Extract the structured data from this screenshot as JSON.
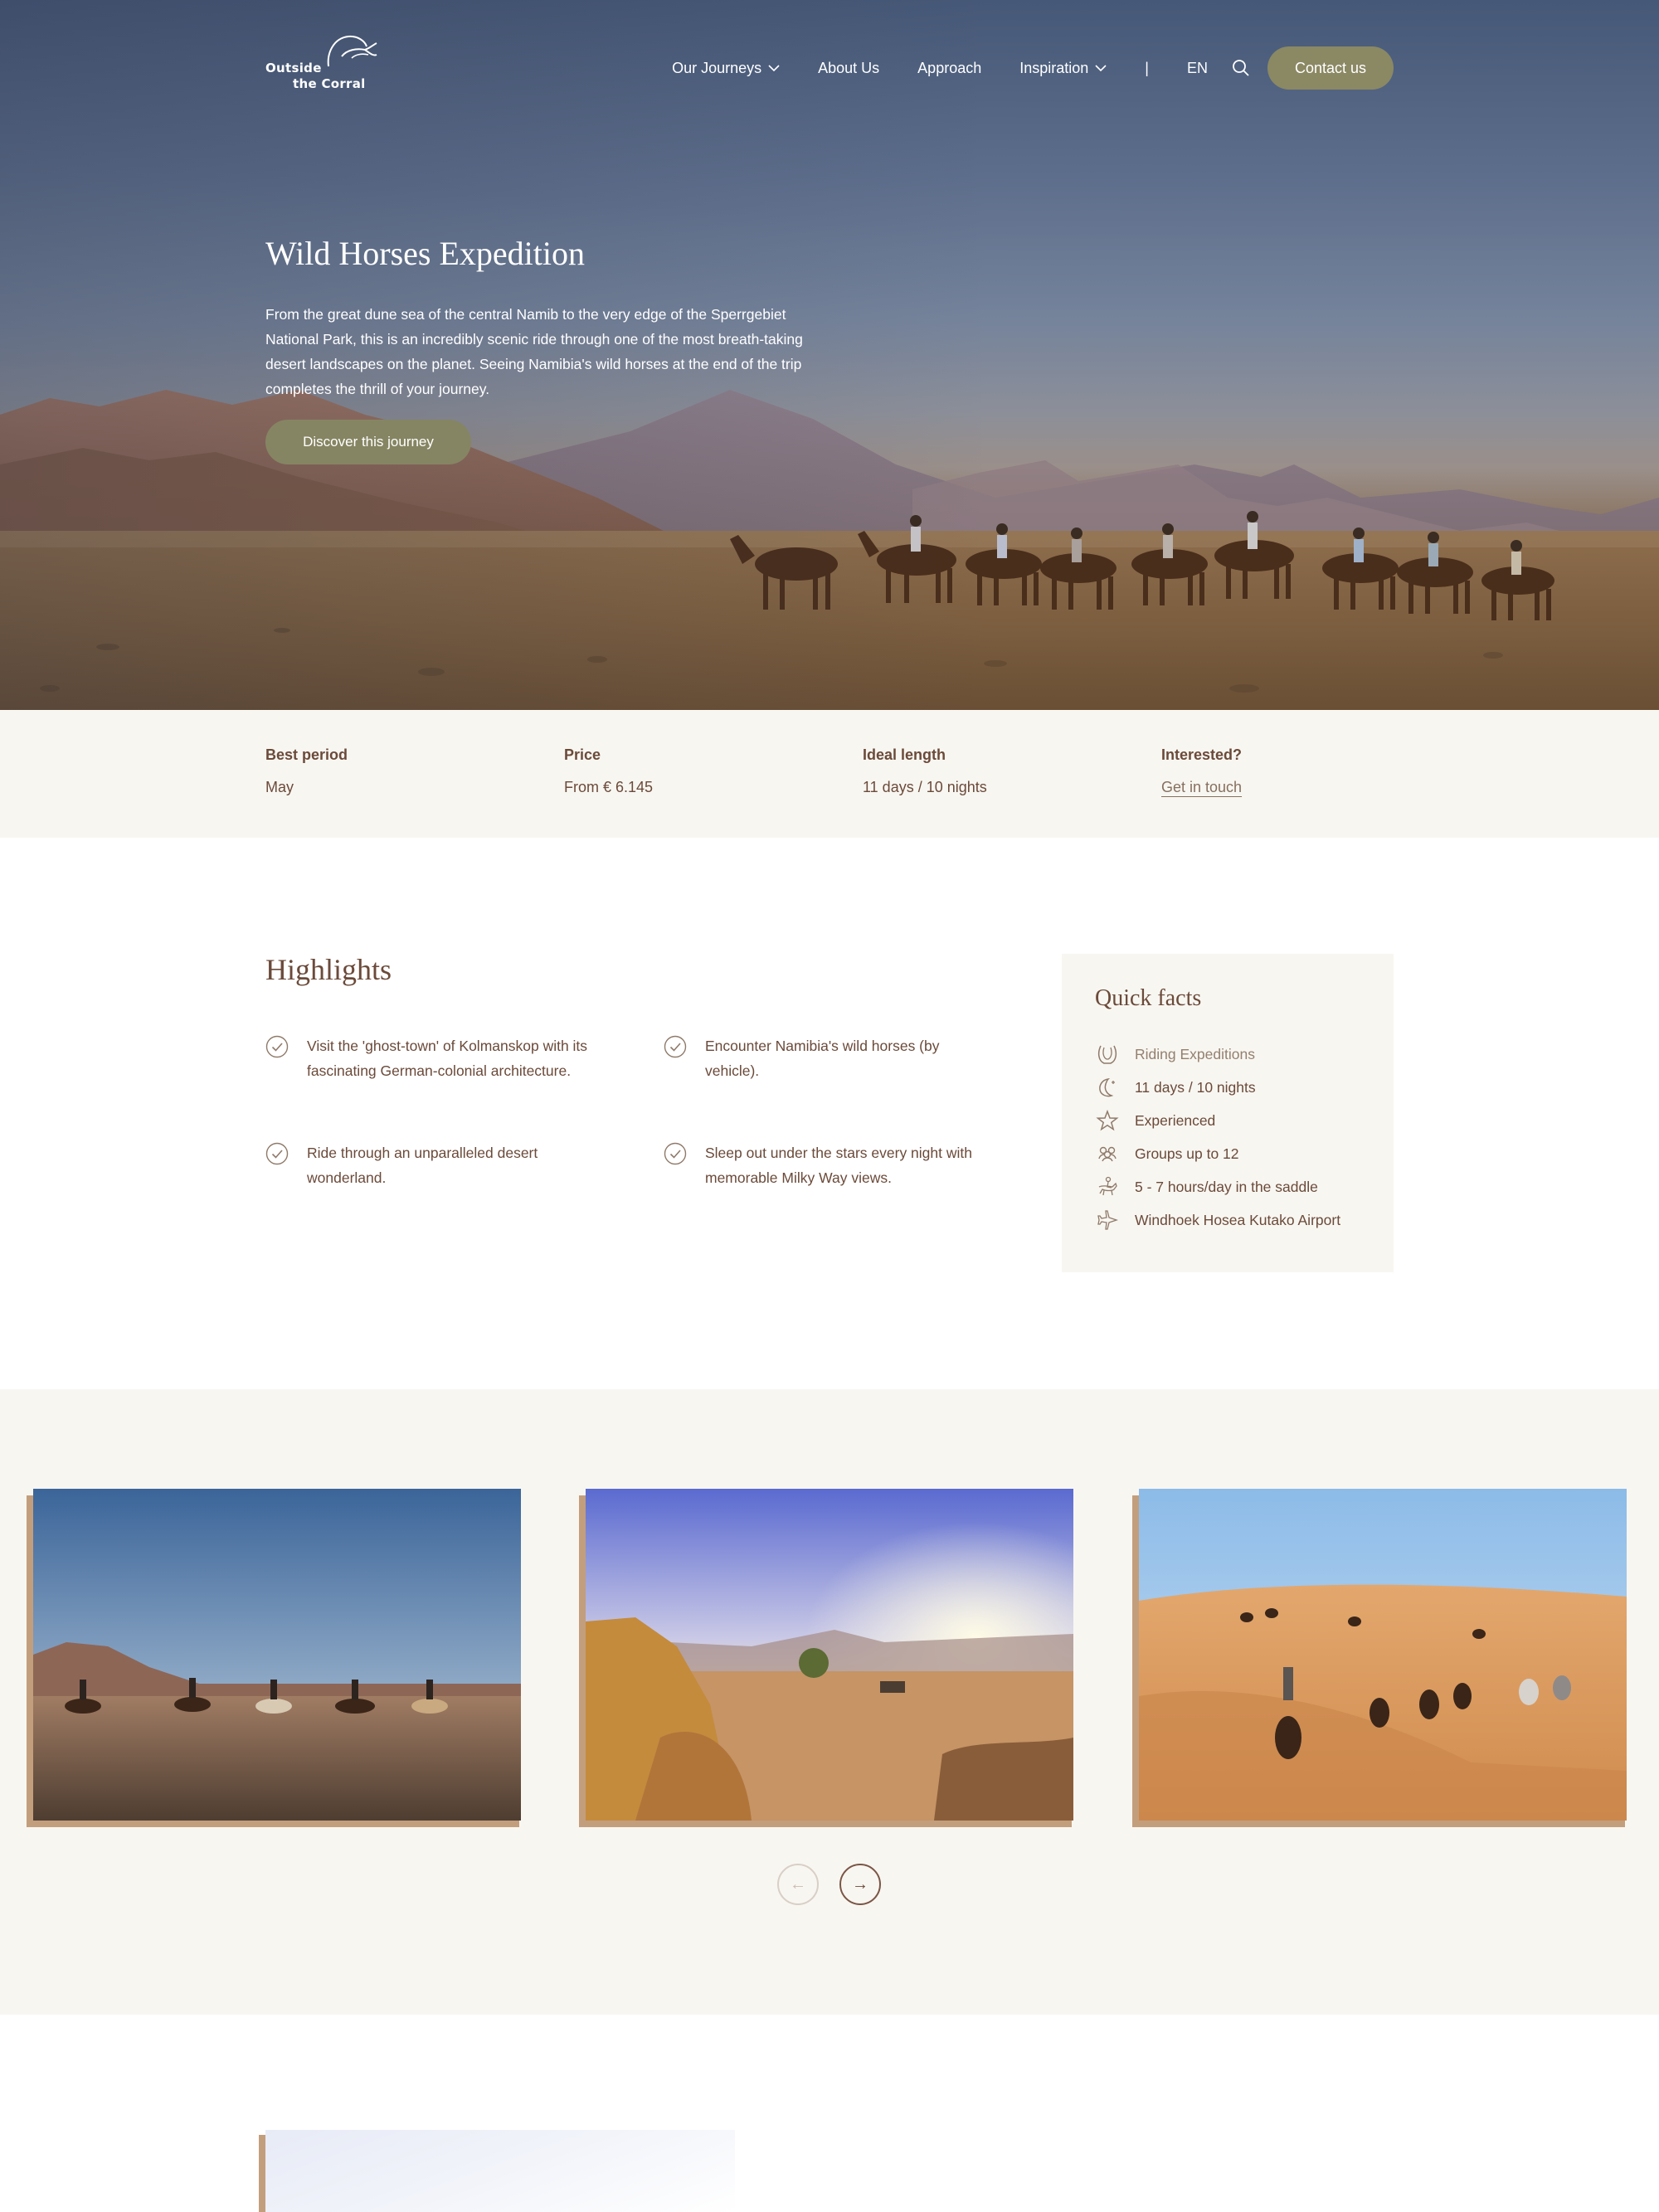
{
  "nav": {
    "logo_line1": "Outside",
    "logo_line2": "the Corral",
    "items": [
      {
        "label": "Our Journeys",
        "has_dropdown": true
      },
      {
        "label": "About Us",
        "has_dropdown": false
      },
      {
        "label": "Approach",
        "has_dropdown": false
      },
      {
        "label": "Inspiration",
        "has_dropdown": true
      }
    ],
    "separator": "|",
    "language": "EN",
    "search_icon": "search-icon",
    "contact_label": "Contact us"
  },
  "hero": {
    "title": "Wild Horses Expedition",
    "description": "From the great dune sea of the central Namib to the very edge of the Sperrgebiet National Park, this is an incredibly scenic ride through one of the most breath-taking desert landscapes on the planet. Seeing Namibia's wild horses at the end of the trip completes the thrill of your journey.",
    "button_label": "Discover this journey"
  },
  "info": [
    {
      "label": "Best period",
      "value": "May"
    },
    {
      "label": "Price",
      "value": "From € 6.145"
    },
    {
      "label": "Ideal length",
      "value": "11 days / 10 nights"
    },
    {
      "label": "Interested?",
      "value": "Get in touch"
    }
  ],
  "highlights": {
    "title": "Highlights",
    "items": [
      "Visit the 'ghost-town' of Kolmanskop with its fascinating German-colonial architecture.",
      "Encounter Namibia's wild horses (by vehicle).",
      "Ride through an unparalleled desert wonderland.",
      "Sleep out under the stars every night with memorable Milky Way views."
    ]
  },
  "quick_facts": {
    "title": "Quick facts",
    "items": [
      {
        "icon": "horseshoe-icon",
        "label": "Riding Expeditions"
      },
      {
        "icon": "moon-icon",
        "label": "11 days / 10 nights"
      },
      {
        "icon": "star-icon",
        "label": "Experienced"
      },
      {
        "icon": "group-icon",
        "label": "Groups up to 12"
      },
      {
        "icon": "rider-icon",
        "label": "5 - 7 hours/day in the saddle"
      },
      {
        "icon": "plane-icon",
        "label": "Windhoek Hosea Kutako Airport"
      }
    ]
  },
  "gallery": {
    "images": [
      "riders-on-plain-photo",
      "desert-camp-sunset-photo",
      "riders-in-dunes-photo"
    ],
    "prev_label": "←",
    "next_label": "→"
  },
  "colors": {
    "brown_text": "#6b4a3a",
    "olive_button": "#8b8864",
    "cream_bg": "#f8f6f1",
    "tan_accent": "#c39e7d"
  }
}
